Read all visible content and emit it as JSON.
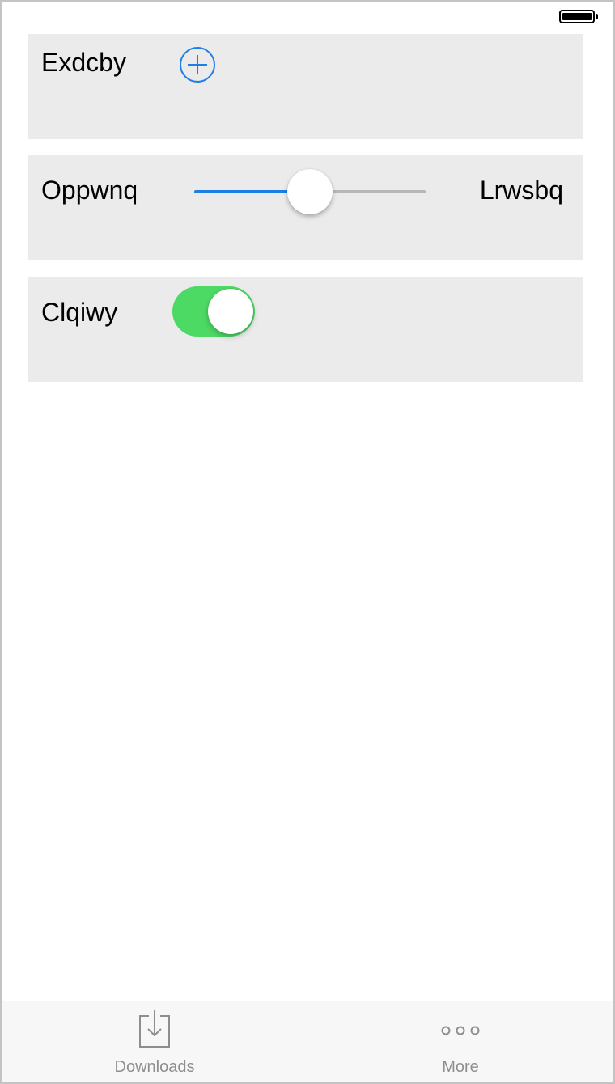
{
  "status_bar": {
    "battery_icon": "battery-full-icon",
    "battery_level": 1.0
  },
  "rows": {
    "row1": {
      "label": "Exdcby",
      "button_icon": "add-circle-icon"
    },
    "row2": {
      "left_label": "Oppwnq",
      "right_label": "Lrwsbq",
      "slider_value": 0.5
    },
    "row3": {
      "label": "Clqiwy",
      "switch_on": true
    }
  },
  "tab_bar": {
    "tabs": [
      {
        "label": "Downloads",
        "icon": "download-tray-icon"
      },
      {
        "label": "More",
        "icon": "more-dots-icon"
      }
    ]
  },
  "colors": {
    "accent": "#1e7ee6",
    "switch_on": "#4cd964",
    "row_background": "#ebebeb",
    "tab_inactive": "#8e8e8e"
  }
}
